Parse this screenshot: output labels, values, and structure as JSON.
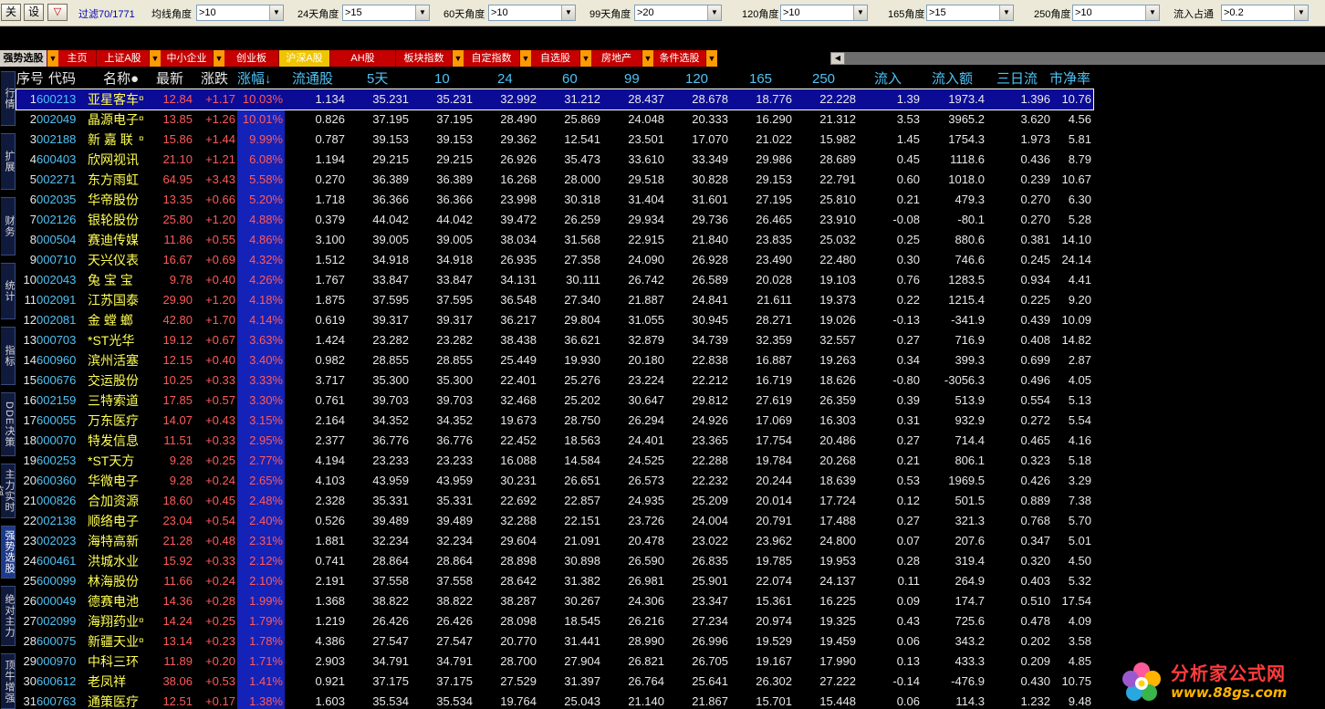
{
  "filterbar": {
    "close_label": "关",
    "settings_label": "设",
    "dropdown_glyph": "▽",
    "filter_count": "过滤70/1771",
    "combos": [
      {
        "label": "均线角度",
        "value": ">10"
      },
      {
        "label": "24天角度",
        "value": ">15"
      },
      {
        "label": "60天角度",
        "value": ">10"
      },
      {
        "label": "99天角度",
        "value": ">20"
      },
      {
        "label": "120角度",
        "value": ">10"
      },
      {
        "label": "165角度",
        "value": ">15"
      },
      {
        "label": "250角度",
        "value": ">10"
      },
      {
        "label": "流入占通",
        "value": ">0.2"
      }
    ]
  },
  "tabs": [
    {
      "label": "强势选股",
      "style": "first",
      "arrow": true
    },
    {
      "label": "主页",
      "arrow": false
    },
    {
      "label": "上证A股",
      "arrow": true
    },
    {
      "label": "中小企业",
      "arrow": true
    },
    {
      "label": "创业板",
      "arrow": false
    },
    {
      "label": "沪深A股",
      "style": "active",
      "arrow": false
    },
    {
      "label": "AH股",
      "arrow": false
    },
    {
      "label": "板块指数",
      "arrow": true
    },
    {
      "label": "自定指数",
      "arrow": true
    },
    {
      "label": "自选股",
      "arrow": true
    },
    {
      "label": "房地产",
      "arrow": true
    },
    {
      "label": "条件选股",
      "arrow": true
    }
  ],
  "sidebar": [
    {
      "label": "行情",
      "active": false
    },
    {
      "label": "扩展",
      "active": false
    },
    {
      "label": "财务",
      "active": false
    },
    {
      "label": "统计",
      "active": false
    },
    {
      "label": "指标",
      "active": false
    },
    {
      "label": "DDE决策",
      "active": false
    },
    {
      "label": "主力实时监",
      "active": false
    },
    {
      "label": "强势选股",
      "active": true
    },
    {
      "label": "绝对主力",
      "active": false
    },
    {
      "label": "顶牛增强",
      "active": false
    }
  ],
  "columns": [
    "序号",
    "代码",
    "名称●",
    "最新",
    "涨跌",
    "涨幅↓",
    "流通股",
    "5天",
    "10",
    "24",
    "60",
    "99",
    "120",
    "165",
    "250",
    "流入",
    "流入额",
    "三日流",
    "市净率"
  ],
  "rows": [
    [
      "1",
      "600213",
      "亚星客车",
      "12.84",
      "+1.17",
      "10.03%",
      "1.134",
      "35.231",
      "35.231",
      "32.992",
      "31.212",
      "28.437",
      "28.678",
      "18.776",
      "22.228",
      "1.39",
      "1973.4",
      "1.396",
      "10.76"
    ],
    [
      "2",
      "002049",
      "晶源电子",
      "13.85",
      "+1.26",
      "10.01%",
      "0.826",
      "37.195",
      "37.195",
      "28.490",
      "25.869",
      "24.048",
      "20.333",
      "16.290",
      "21.312",
      "3.53",
      "3965.2",
      "3.620",
      "4.56"
    ],
    [
      "3",
      "002188",
      "新 嘉 联",
      "15.86",
      "+1.44",
      "9.99%",
      "0.787",
      "39.153",
      "39.153",
      "29.362",
      "12.541",
      "23.501",
      "17.070",
      "21.022",
      "15.982",
      "1.45",
      "1754.3",
      "1.973",
      "5.81"
    ],
    [
      "4",
      "600403",
      "欣网视讯",
      "21.10",
      "+1.21",
      "6.08%",
      "1.194",
      "29.215",
      "29.215",
      "26.926",
      "35.473",
      "33.610",
      "33.349",
      "29.986",
      "28.689",
      "0.45",
      "1118.6",
      "0.436",
      "8.79"
    ],
    [
      "5",
      "002271",
      "东方雨虹",
      "64.95",
      "+3.43",
      "5.58%",
      "0.270",
      "36.389",
      "36.389",
      "16.268",
      "28.000",
      "29.518",
      "30.828",
      "29.153",
      "22.791",
      "0.60",
      "1018.0",
      "0.239",
      "10.67"
    ],
    [
      "6",
      "002035",
      "华帝股份",
      "13.35",
      "+0.66",
      "5.20%",
      "1.718",
      "36.366",
      "36.366",
      "23.998",
      "30.318",
      "31.404",
      "31.601",
      "27.195",
      "25.810",
      "0.21",
      "479.3",
      "0.270",
      "6.30"
    ],
    [
      "7",
      "002126",
      "银轮股份",
      "25.80",
      "+1.20",
      "4.88%",
      "0.379",
      "44.042",
      "44.042",
      "39.472",
      "26.259",
      "29.934",
      "29.736",
      "26.465",
      "23.910",
      "-0.08",
      "-80.1",
      "0.270",
      "5.28"
    ],
    [
      "8",
      "000504",
      "赛迪传媒",
      "11.86",
      "+0.55",
      "4.86%",
      "3.100",
      "39.005",
      "39.005",
      "38.034",
      "31.568",
      "22.915",
      "21.840",
      "23.835",
      "25.032",
      "0.25",
      "880.6",
      "0.381",
      "14.10"
    ],
    [
      "9",
      "000710",
      "天兴仪表",
      "16.67",
      "+0.69",
      "4.32%",
      "1.512",
      "34.918",
      "34.918",
      "26.935",
      "27.358",
      "24.090",
      "26.928",
      "23.490",
      "22.480",
      "0.30",
      "746.6",
      "0.245",
      "24.14"
    ],
    [
      "10",
      "002043",
      "兔 宝 宝",
      "9.78",
      "+0.40",
      "4.26%",
      "1.767",
      "33.847",
      "33.847",
      "34.131",
      "30.111",
      "26.742",
      "26.589",
      "20.028",
      "19.103",
      "0.76",
      "1283.5",
      "0.934",
      "4.41"
    ],
    [
      "11",
      "002091",
      "江苏国泰",
      "29.90",
      "+1.20",
      "4.18%",
      "1.875",
      "37.595",
      "37.595",
      "36.548",
      "27.340",
      "21.887",
      "24.841",
      "21.611",
      "19.373",
      "0.22",
      "1215.4",
      "0.225",
      "9.20"
    ],
    [
      "12",
      "002081",
      "金 螳 螂",
      "42.80",
      "+1.70",
      "4.14%",
      "0.619",
      "39.317",
      "39.317",
      "36.217",
      "29.804",
      "31.055",
      "30.945",
      "28.271",
      "19.026",
      "-0.13",
      "-341.9",
      "0.439",
      "10.09"
    ],
    [
      "13",
      "000703",
      "*ST光华",
      "19.12",
      "+0.67",
      "3.63%",
      "1.424",
      "23.282",
      "23.282",
      "38.438",
      "36.621",
      "32.879",
      "34.739",
      "32.359",
      "32.557",
      "0.27",
      "716.9",
      "0.408",
      "14.82"
    ],
    [
      "14",
      "600960",
      "滨州活塞",
      "12.15",
      "+0.40",
      "3.40%",
      "0.982",
      "28.855",
      "28.855",
      "25.449",
      "19.930",
      "20.180",
      "22.838",
      "16.887",
      "19.263",
      "0.34",
      "399.3",
      "0.699",
      "2.87"
    ],
    [
      "15",
      "600676",
      "交运股份",
      "10.25",
      "+0.33",
      "3.33%",
      "3.717",
      "35.300",
      "35.300",
      "22.401",
      "25.276",
      "23.224",
      "22.212",
      "16.719",
      "18.626",
      "-0.80",
      "-3056.3",
      "0.496",
      "4.05"
    ],
    [
      "16",
      "002159",
      "三特索道",
      "17.85",
      "+0.57",
      "3.30%",
      "0.761",
      "39.703",
      "39.703",
      "32.468",
      "25.202",
      "30.647",
      "29.812",
      "27.619",
      "26.359",
      "0.39",
      "513.9",
      "0.554",
      "5.13"
    ],
    [
      "17",
      "600055",
      "万东医疗",
      "14.07",
      "+0.43",
      "3.15%",
      "2.164",
      "34.352",
      "34.352",
      "19.673",
      "28.750",
      "26.294",
      "24.926",
      "17.069",
      "16.303",
      "0.31",
      "932.9",
      "0.272",
      "5.54"
    ],
    [
      "18",
      "000070",
      "特发信息",
      "11.51",
      "+0.33",
      "2.95%",
      "2.377",
      "36.776",
      "36.776",
      "22.452",
      "18.563",
      "24.401",
      "23.365",
      "17.754",
      "20.486",
      "0.27",
      "714.4",
      "0.465",
      "4.16"
    ],
    [
      "19",
      "600253",
      "*ST天方",
      "9.28",
      "+0.25",
      "2.77%",
      "4.194",
      "23.233",
      "23.233",
      "16.088",
      "14.584",
      "24.525",
      "22.288",
      "19.784",
      "20.268",
      "0.21",
      "806.1",
      "0.323",
      "5.18"
    ],
    [
      "20",
      "600360",
      "华微电子",
      "9.28",
      "+0.24",
      "2.65%",
      "4.103",
      "43.959",
      "43.959",
      "30.231",
      "26.651",
      "26.573",
      "22.232",
      "20.244",
      "18.639",
      "0.53",
      "1969.5",
      "0.426",
      "3.29"
    ],
    [
      "21",
      "000826",
      "合加资源",
      "18.60",
      "+0.45",
      "2.48%",
      "2.328",
      "35.331",
      "35.331",
      "22.692",
      "22.857",
      "24.935",
      "25.209",
      "20.014",
      "17.724",
      "0.12",
      "501.5",
      "0.889",
      "7.38"
    ],
    [
      "22",
      "002138",
      "顺络电子",
      "23.04",
      "+0.54",
      "2.40%",
      "0.526",
      "39.489",
      "39.489",
      "32.288",
      "22.151",
      "23.726",
      "24.004",
      "20.791",
      "17.488",
      "0.27",
      "321.3",
      "0.768",
      "5.70"
    ],
    [
      "23",
      "002023",
      "海特高新",
      "21.28",
      "+0.48",
      "2.31%",
      "1.881",
      "32.234",
      "32.234",
      "29.604",
      "21.091",
      "20.478",
      "23.022",
      "23.962",
      "24.800",
      "0.07",
      "207.6",
      "0.347",
      "5.01"
    ],
    [
      "24",
      "600461",
      "洪城水业",
      "15.92",
      "+0.33",
      "2.12%",
      "0.741",
      "28.864",
      "28.864",
      "28.898",
      "30.898",
      "26.590",
      "26.835",
      "19.785",
      "19.953",
      "0.28",
      "319.4",
      "0.320",
      "4.50"
    ],
    [
      "25",
      "600099",
      "林海股份",
      "11.66",
      "+0.24",
      "2.10%",
      "2.191",
      "37.558",
      "37.558",
      "28.642",
      "31.382",
      "26.981",
      "25.901",
      "22.074",
      "24.137",
      "0.11",
      "264.9",
      "0.403",
      "5.32"
    ],
    [
      "26",
      "000049",
      "德赛电池",
      "14.36",
      "+0.28",
      "1.99%",
      "1.368",
      "38.822",
      "38.822",
      "38.287",
      "30.267",
      "24.306",
      "23.347",
      "15.361",
      "16.225",
      "0.09",
      "174.7",
      "0.510",
      "17.54"
    ],
    [
      "27",
      "002099",
      "海翔药业",
      "14.24",
      "+0.25",
      "1.79%",
      "1.219",
      "26.426",
      "26.426",
      "28.098",
      "18.545",
      "26.216",
      "27.234",
      "20.974",
      "19.325",
      "0.43",
      "725.6",
      "0.478",
      "4.09"
    ],
    [
      "28",
      "600075",
      "新疆天业",
      "13.14",
      "+0.23",
      "1.78%",
      "4.386",
      "27.547",
      "27.547",
      "20.770",
      "31.441",
      "28.990",
      "26.996",
      "19.529",
      "19.459",
      "0.06",
      "343.2",
      "0.202",
      "3.58"
    ],
    [
      "29",
      "000970",
      "中科三环",
      "11.89",
      "+0.20",
      "1.71%",
      "2.903",
      "34.791",
      "34.791",
      "28.700",
      "27.904",
      "26.821",
      "26.705",
      "19.167",
      "17.990",
      "0.13",
      "433.3",
      "0.209",
      "4.85"
    ],
    [
      "30",
      "600612",
      "老凤祥",
      "38.06",
      "+0.53",
      "1.41%",
      "0.921",
      "37.175",
      "37.175",
      "27.529",
      "31.397",
      "26.764",
      "25.641",
      "26.302",
      "27.222",
      "-0.14",
      "-476.9",
      "0.430",
      "10.75"
    ],
    [
      "31",
      "600763",
      "通策医疗",
      "12.51",
      "+0.17",
      "1.38%",
      "1.603",
      "35.534",
      "35.534",
      "19.764",
      "25.043",
      "21.140",
      "21.867",
      "15.701",
      "15.448",
      "0.06",
      "114.3",
      "1.232",
      "9.48"
    ]
  ],
  "name_marks": [
    "1",
    "2",
    "3",
    "27",
    "28"
  ],
  "watermark": {
    "title": "分析家公式网",
    "url": "www.88gs.com"
  },
  "colors": {
    "up": "#ff5a5a",
    "name": "#ffff54",
    "code": "#4fc3f7",
    "band": "#1422b8",
    "selected": "#0b0b96"
  }
}
